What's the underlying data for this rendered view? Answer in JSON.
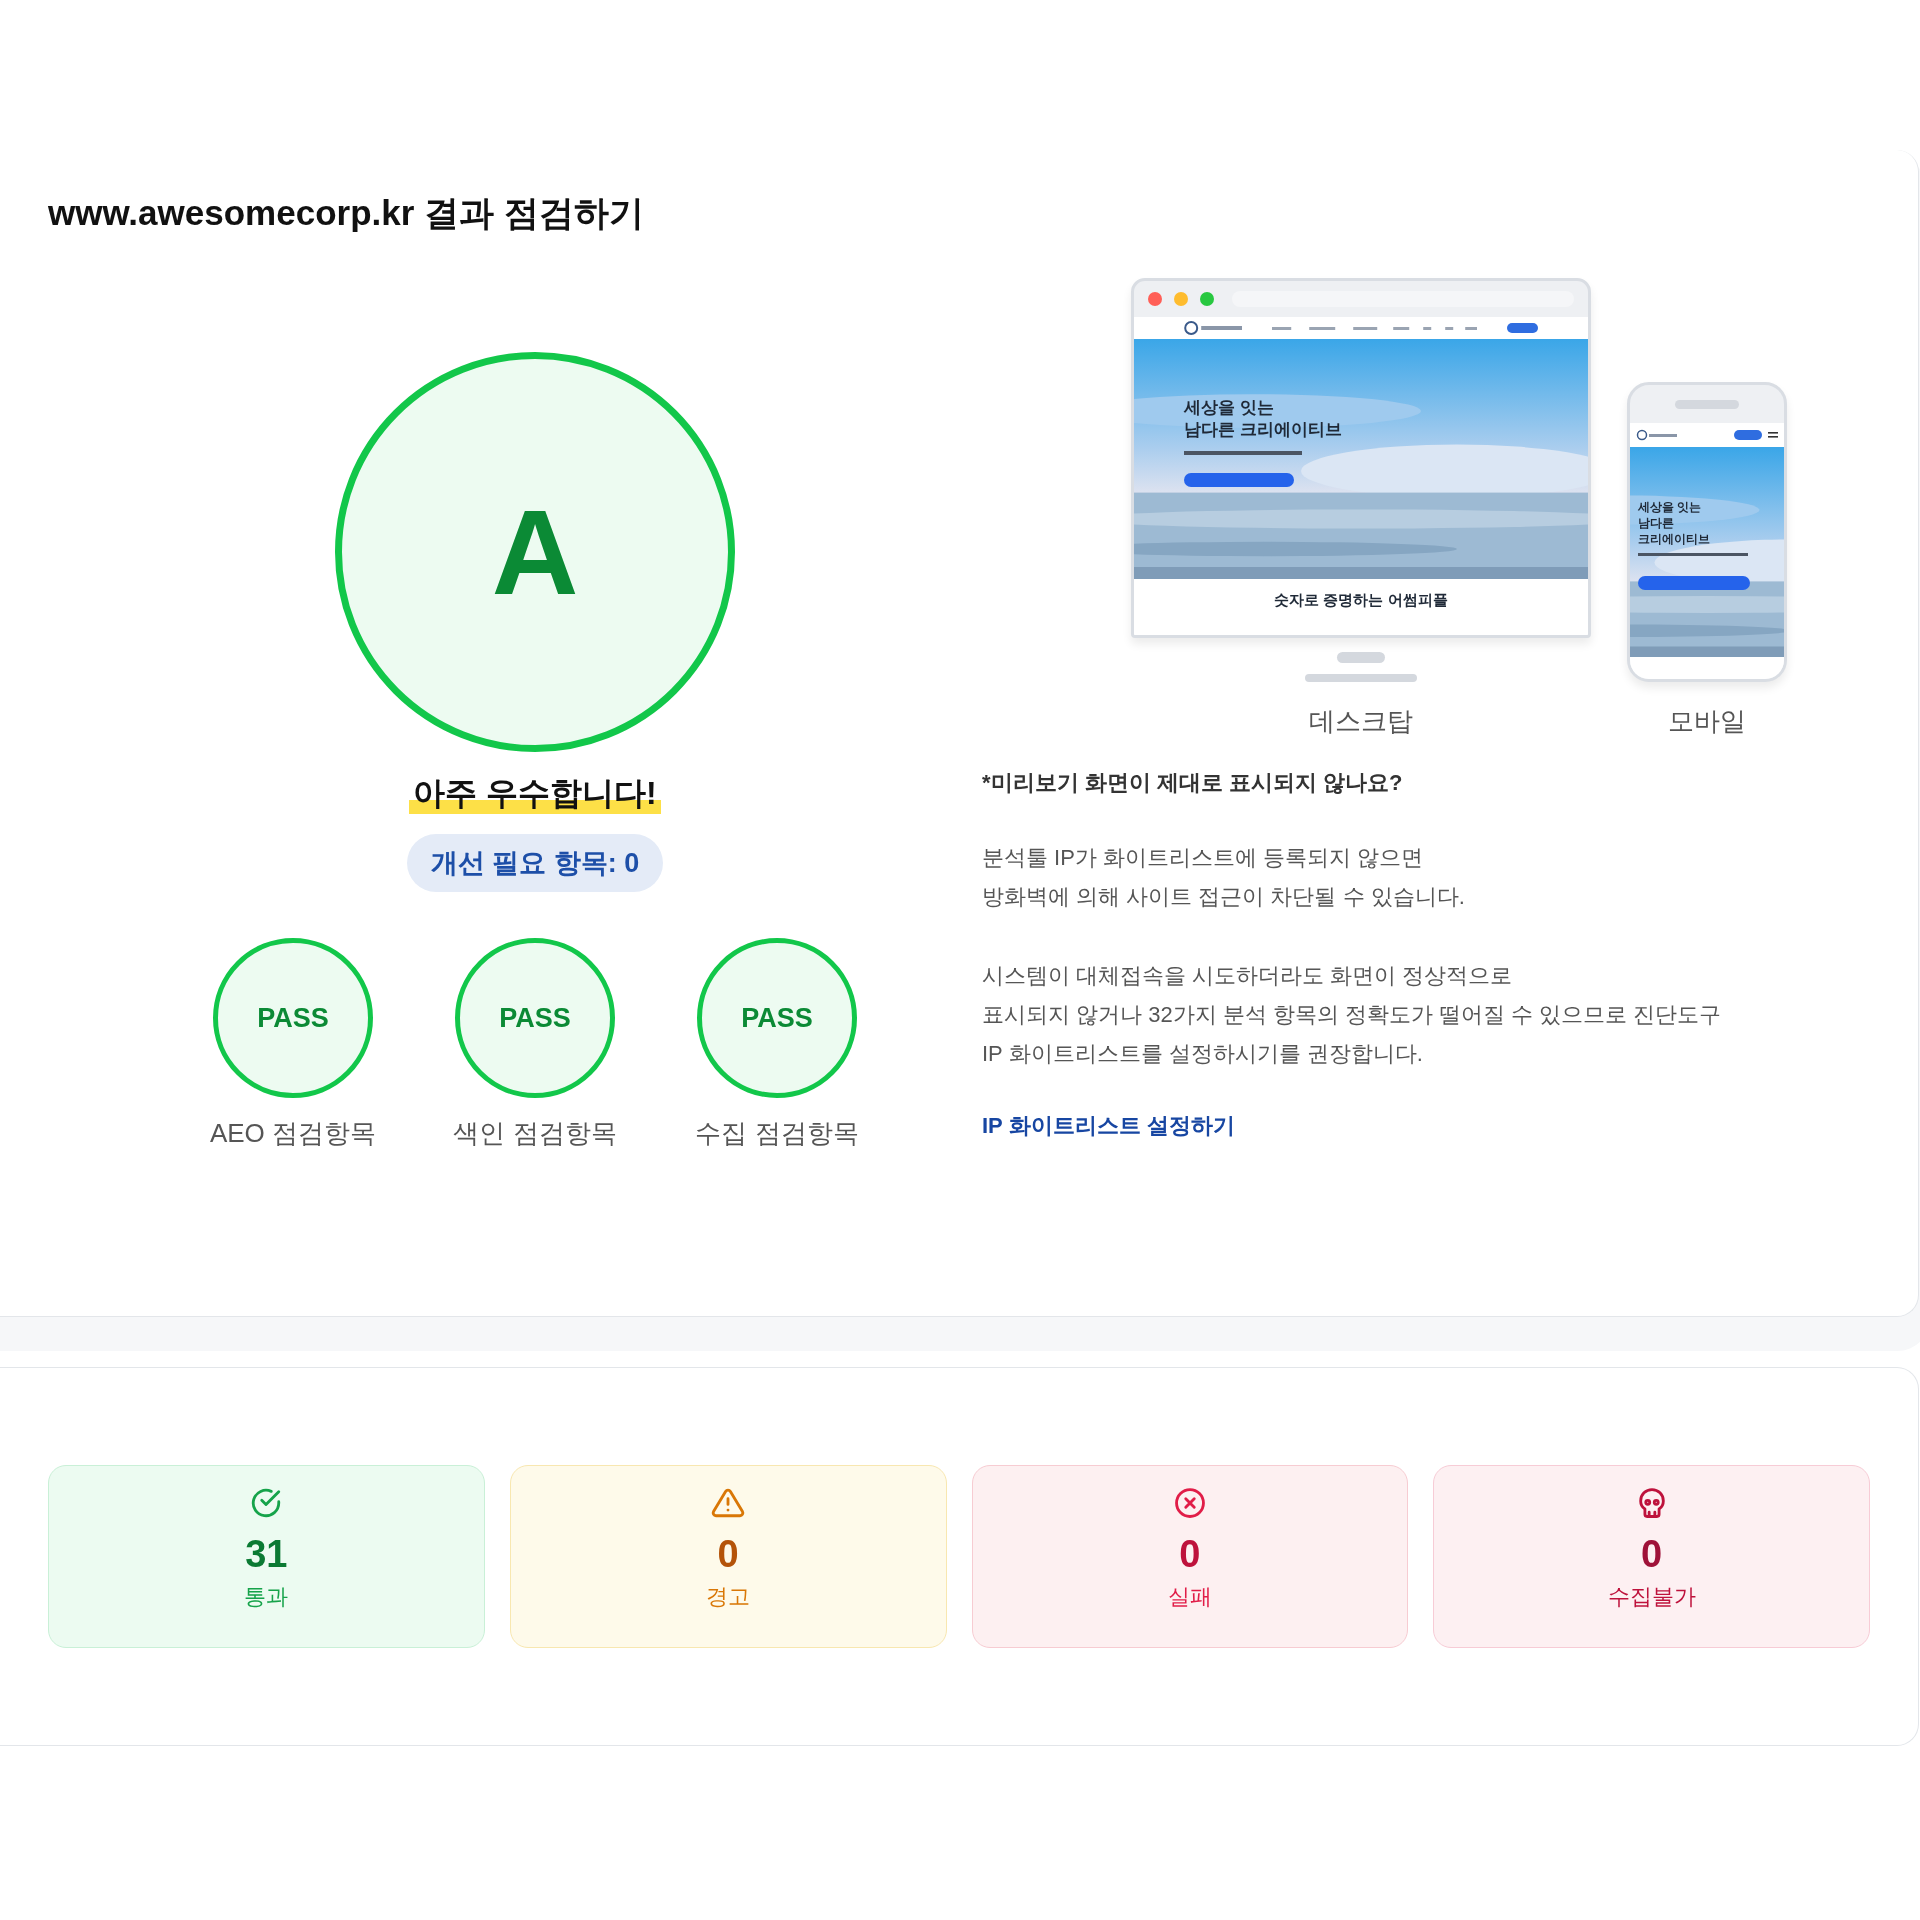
{
  "title": "www.awesomecorp.kr 결과 점검하기",
  "grade": {
    "letter": "A",
    "verdict": "아주 우수합니다!",
    "issues": "개선 필요 항목: 0"
  },
  "checks": [
    {
      "result": "PASS",
      "label": "AEO 점검항목"
    },
    {
      "result": "PASS",
      "label": "색인 점검항목"
    },
    {
      "result": "PASS",
      "label": "수집 점검항목"
    }
  ],
  "previews": [
    {
      "kind": "desktop",
      "label": "데스크탑",
      "headline": [
        "세상을 잇는",
        "남다른 크리에이티브"
      ],
      "section_title": "숫자로 증명하는 어썸피플"
    },
    {
      "kind": "mobile",
      "label": "모바일",
      "headline": [
        "세상을 잇는",
        "남다른",
        "크리에이티브"
      ]
    }
  ],
  "notice": {
    "question": "*미리보기 화면이 제대로 표시되지 않나요?",
    "paragraphs": [
      [
        "분석툴 IP가 화이트리스트에 등록되지 않으면",
        "방화벽에 의해 사이트 접근이 차단될 수 있습니다."
      ],
      [
        "시스템이 대체접속을 시도하더라도 화면이 정상적으로",
        "표시되지 않거나 32가지 분석 항목의 정확도가 떨어질 수 있으므로 진단도구",
        "IP 화이트리스트를 설정하시기를 권장합니다."
      ]
    ],
    "link": "IP 화이트리스트 설정하기"
  },
  "summary": [
    {
      "kind": "pass",
      "count": "31",
      "label": "통과"
    },
    {
      "kind": "warning",
      "count": "0",
      "label": "경고"
    },
    {
      "kind": "fail",
      "count": "0",
      "label": "실패"
    },
    {
      "kind": "blocked",
      "count": "0",
      "label": "수집불가"
    }
  ]
}
